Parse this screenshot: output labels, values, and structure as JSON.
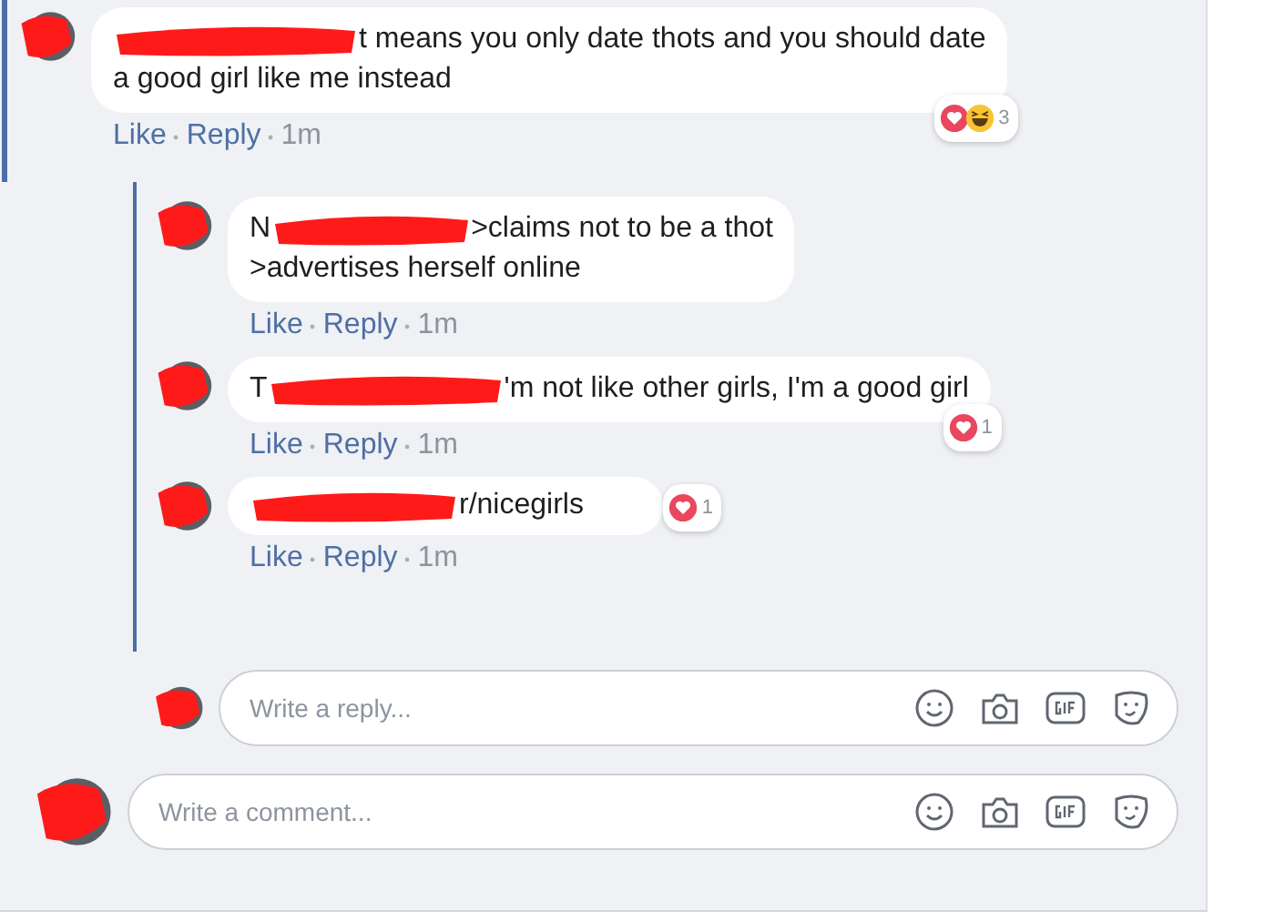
{
  "comment": {
    "lines": [
      "t means you only date thots and you should date",
      "a good girl like me instead"
    ],
    "actions": [
      "Like",
      "Reply",
      "1m"
    ],
    "reactions": {
      "love": true,
      "haha": true,
      "count": "3"
    }
  },
  "replies": [
    {
      "lead": "N",
      "lines": [
        ">claims not to be a thot",
        ">advertises herself online"
      ],
      "actions": [
        "Like",
        "Reply",
        "1m"
      ]
    },
    {
      "lead": "T",
      "lines": [
        "'m not like other girls, I'm a good girl"
      ],
      "actions": [
        "Like",
        "Reply",
        "1m"
      ],
      "reactions": {
        "love": true,
        "haha": false,
        "count": "1"
      }
    },
    {
      "lines": [
        "r/nicegirls"
      ],
      "actions": [
        "Like",
        "Reply",
        "1m"
      ],
      "reactions": {
        "love": true,
        "haha": false,
        "count": "1"
      },
      "inline_reactions": true
    }
  ],
  "reply_box": {
    "placeholder": "Write a reply..."
  },
  "comment_box": {
    "placeholder": "Write a comment..."
  }
}
